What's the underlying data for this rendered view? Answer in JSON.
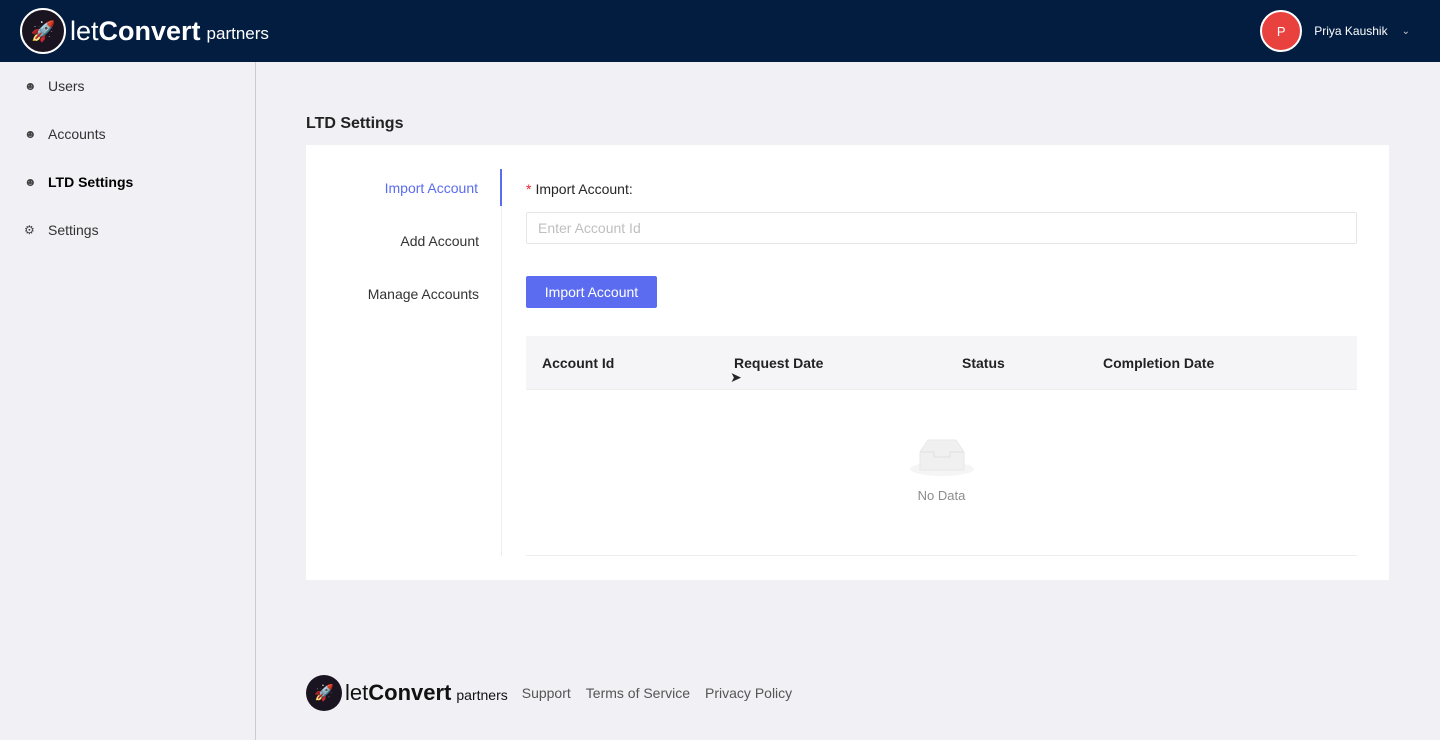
{
  "brand": {
    "let": "let",
    "convert": "Convert",
    "partners": "partners"
  },
  "user": {
    "initial": "P",
    "name": "Priya Kaushik"
  },
  "sidebar": {
    "items": [
      {
        "label": "Users",
        "icon": "user-icon"
      },
      {
        "label": "Accounts",
        "icon": "user-icon"
      },
      {
        "label": "LTD Settings",
        "icon": "user-icon",
        "active": true
      },
      {
        "label": "Settings",
        "icon": "gear-icon"
      }
    ]
  },
  "page": {
    "title": "LTD Settings"
  },
  "tabs": [
    "Import Account",
    "Add Account",
    "Manage Accounts"
  ],
  "form": {
    "label": "Import Account",
    "required_mark": "*",
    "colon": ":",
    "placeholder": "Enter Account Id",
    "value": "",
    "button": "Import Account"
  },
  "table": {
    "columns": [
      "Account Id",
      "Request Date",
      "Status",
      "Completion Date"
    ],
    "empty": "No Data"
  },
  "footer": {
    "links": [
      "Support",
      "Terms of Service",
      "Privacy Policy"
    ]
  }
}
